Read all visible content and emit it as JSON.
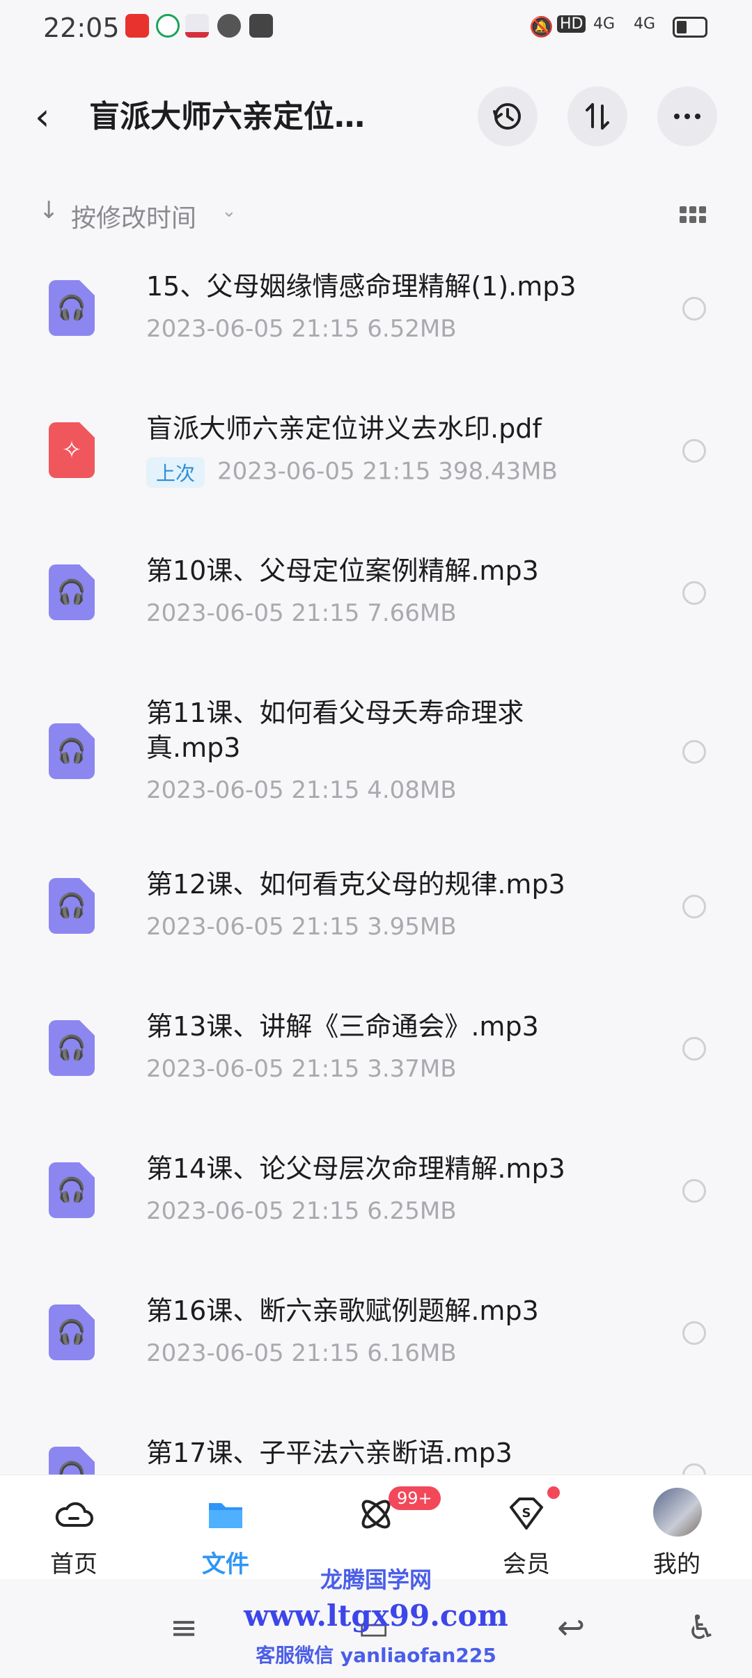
{
  "status_bar": {
    "time": "22:05",
    "hd": "HD",
    "signal1": "4G",
    "signal2": "4G"
  },
  "header": {
    "title": "盲派大师六亲定位…",
    "icons": [
      "back-arrow-icon",
      "history-icon",
      "sort-icon",
      "more-icon"
    ]
  },
  "sort": {
    "label": "按修改时间"
  },
  "files": [
    {
      "name": "15、父母姻缘情感命理精解(1).mp3",
      "meta": "2023-06-05  21:15  6.52MB",
      "type": "audio",
      "badge": ""
    },
    {
      "name": "盲派大师六亲定位讲义去水印.pdf",
      "meta": "2023-06-05  21:15  398.43MB",
      "type": "pdf",
      "badge": "上次"
    },
    {
      "name": "第10课、父母定位案例精解.mp3",
      "meta": "2023-06-05  21:15  7.66MB",
      "type": "audio",
      "badge": ""
    },
    {
      "name": "第11课、如何看父母夭寿命理求真.mp3",
      "meta": "2023-06-05  21:15  4.08MB",
      "type": "audio",
      "badge": ""
    },
    {
      "name": "第12课、如何看克父母的规律.mp3",
      "meta": "2023-06-05  21:15  3.95MB",
      "type": "audio",
      "badge": ""
    },
    {
      "name": "第13课、讲解《三命通会》.mp3",
      "meta": "2023-06-05  21:15  3.37MB",
      "type": "audio",
      "badge": ""
    },
    {
      "name": "第14课、论父母层次命理精解.mp3",
      "meta": "2023-06-05  21:15  6.25MB",
      "type": "audio",
      "badge": ""
    },
    {
      "name": "第16课、断六亲歌赋例题解.mp3",
      "meta": "2023-06-05  21:15  6.16MB",
      "type": "audio",
      "badge": ""
    },
    {
      "name": "第17课、子平法六亲断语.mp3",
      "meta": "",
      "type": "audio",
      "badge": ""
    }
  ],
  "bottom_nav": [
    {
      "label": "首页",
      "icon": "cloud-icon"
    },
    {
      "label": "文件",
      "icon": "folder-icon",
      "active": true
    },
    {
      "label": "",
      "icon": "atom-icon",
      "badge": "99+"
    },
    {
      "label": "会员",
      "icon": "vip-shield-icon"
    },
    {
      "label": "我的",
      "icon": "avatar"
    }
  ],
  "watermark": {
    "line1": "龙腾国学网",
    "line2": "www.ltgx99.com",
    "line3": "客服微信 yanliaofan225"
  },
  "colors": {
    "accent": "#2f96f5",
    "audio_icon": "#8c86f1",
    "pdf_icon": "#f0575d",
    "badge_red": "#f2485a"
  }
}
